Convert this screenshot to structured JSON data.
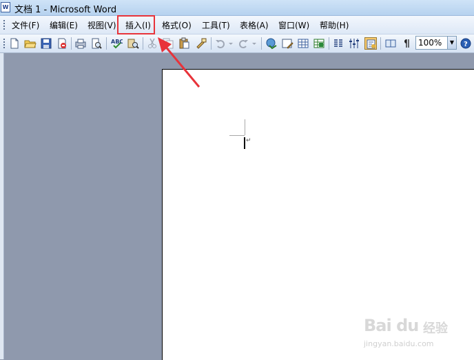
{
  "window": {
    "title": "文档 1 - Microsoft Word"
  },
  "menu": {
    "items": [
      "文件(F)",
      "编辑(E)",
      "视图(V)",
      "插入(I)",
      "格式(O)",
      "工具(T)",
      "表格(A)",
      "窗口(W)",
      "帮助(H)"
    ],
    "highlighted": "插入(I)"
  },
  "toolbar": {
    "icons": [
      "new-document-icon",
      "open-folder-icon",
      "save-icon",
      "permission-icon",
      "print-icon",
      "print-preview-icon",
      "spelling-icon",
      "research-icon",
      "cut-icon",
      "copy-icon",
      "paste-icon",
      "format-painter-icon",
      "undo-icon",
      "undo-dropdown-icon",
      "redo-icon",
      "redo-dropdown-icon",
      "hyperlink-icon",
      "tables-borders-icon",
      "insert-table-icon",
      "insert-excel-icon",
      "columns-icon",
      "drawing-icon",
      "document-map-icon",
      "reading-icon",
      "show-hide-icon"
    ],
    "zoom": "100%"
  },
  "annotation": {
    "color": "#e8333a"
  },
  "watermark": {
    "brand": "Bai du",
    "cn": "经验",
    "url": "jingyan.baidu.com"
  }
}
